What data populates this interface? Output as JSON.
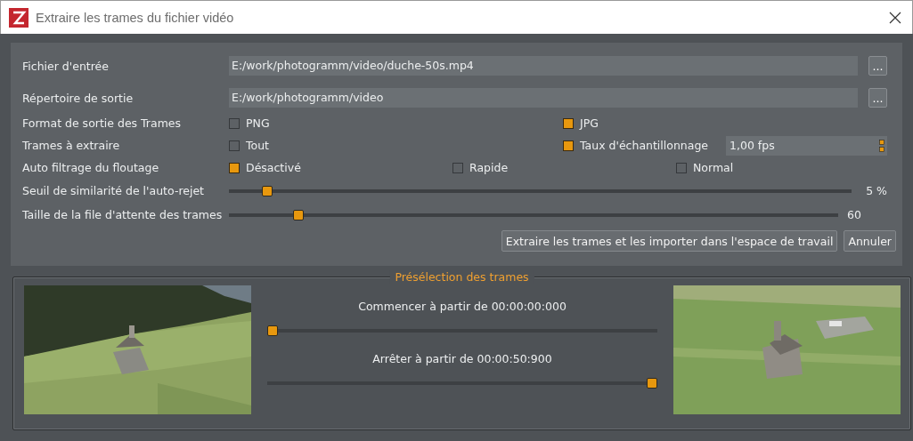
{
  "window": {
    "title": "Extraire les trames du fichier vidéo"
  },
  "file_rows": [
    {
      "label": "Fichier d'entrée",
      "value": "E:/work/photogramm/video/duche-50s.mp4",
      "button": "..."
    },
    {
      "label": "Répertoire de sortie",
      "value": "E:/work/photogramm/video",
      "button": "..."
    }
  ],
  "option_rows": [
    {
      "label": "Format de sortie des Trames",
      "options": [
        {
          "label": "PNG",
          "checked": false
        },
        {
          "label": "JPG",
          "checked": true
        }
      ]
    },
    {
      "label": "Trames à extraire",
      "options": [
        {
          "label": "Tout",
          "checked": false
        },
        {
          "label": "Taux d'échantillonnage",
          "checked": true,
          "spin_value": "1,00 fps"
        }
      ]
    },
    {
      "label": "Auto filtrage du floutage",
      "options": [
        {
          "label": "Désactivé",
          "checked": true
        },
        {
          "label": "Rapide",
          "checked": false
        },
        {
          "label": "Normal",
          "checked": false
        }
      ]
    }
  ],
  "sliders": [
    {
      "label": "Seuil de similarité de l'auto-rejet",
      "level": 0.054,
      "reading": "5 %"
    },
    {
      "label": "Taille de la file d'attente des trames",
      "level": 0.107,
      "reading": "60"
    }
  ],
  "buttons": [
    "Extraire les trames et les importer dans l'espace de travail",
    "Annuler"
  ],
  "preview": {
    "title": "Présélection des trames",
    "start": {
      "label": "Commencer à partir de 00:00:00:000",
      "level": 0
    },
    "stop": {
      "label": "Arrêter à partir de 00:00:50:900",
      "level": 1
    }
  }
}
